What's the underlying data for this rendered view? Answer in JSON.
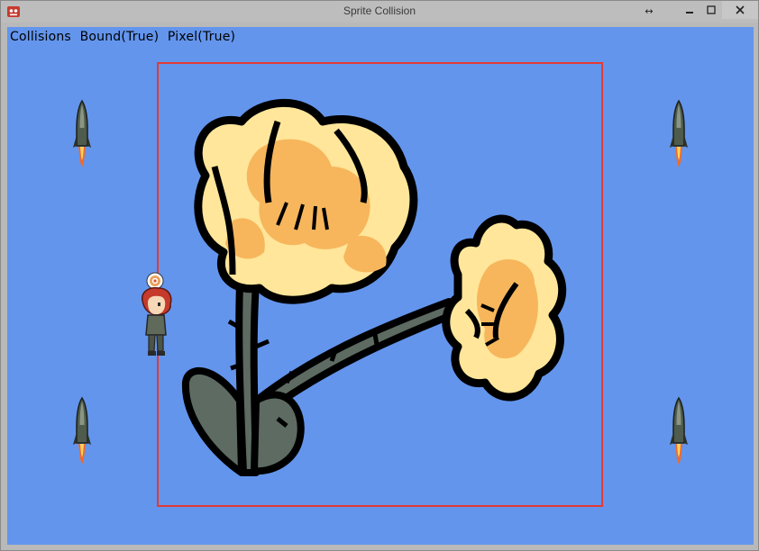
{
  "window": {
    "title": "Sprite Collision",
    "buttons": {
      "resize": "↔",
      "minimize": "minimize",
      "maximize": "maximize",
      "close": "close"
    }
  },
  "status": {
    "label": "Collisions",
    "bound": "Bound(True)",
    "pixel": "Pixel(True)"
  },
  "colors": {
    "background": "#6395ed",
    "bounds_border": "#e43a34",
    "petal_light": "#ffe69a",
    "petal_orange": "#f7b65c",
    "stem": "#5d6b63",
    "outline": "#000000"
  },
  "sprites": [
    {
      "name": "rocket",
      "icon": "rocket-icon"
    },
    {
      "name": "rocket",
      "icon": "rocket-icon"
    },
    {
      "name": "rocket",
      "icon": "rocket-icon"
    },
    {
      "name": "rocket",
      "icon": "rocket-icon"
    },
    {
      "name": "flower",
      "icon": "flower-icon"
    },
    {
      "name": "player",
      "icon": "character-icon"
    }
  ]
}
